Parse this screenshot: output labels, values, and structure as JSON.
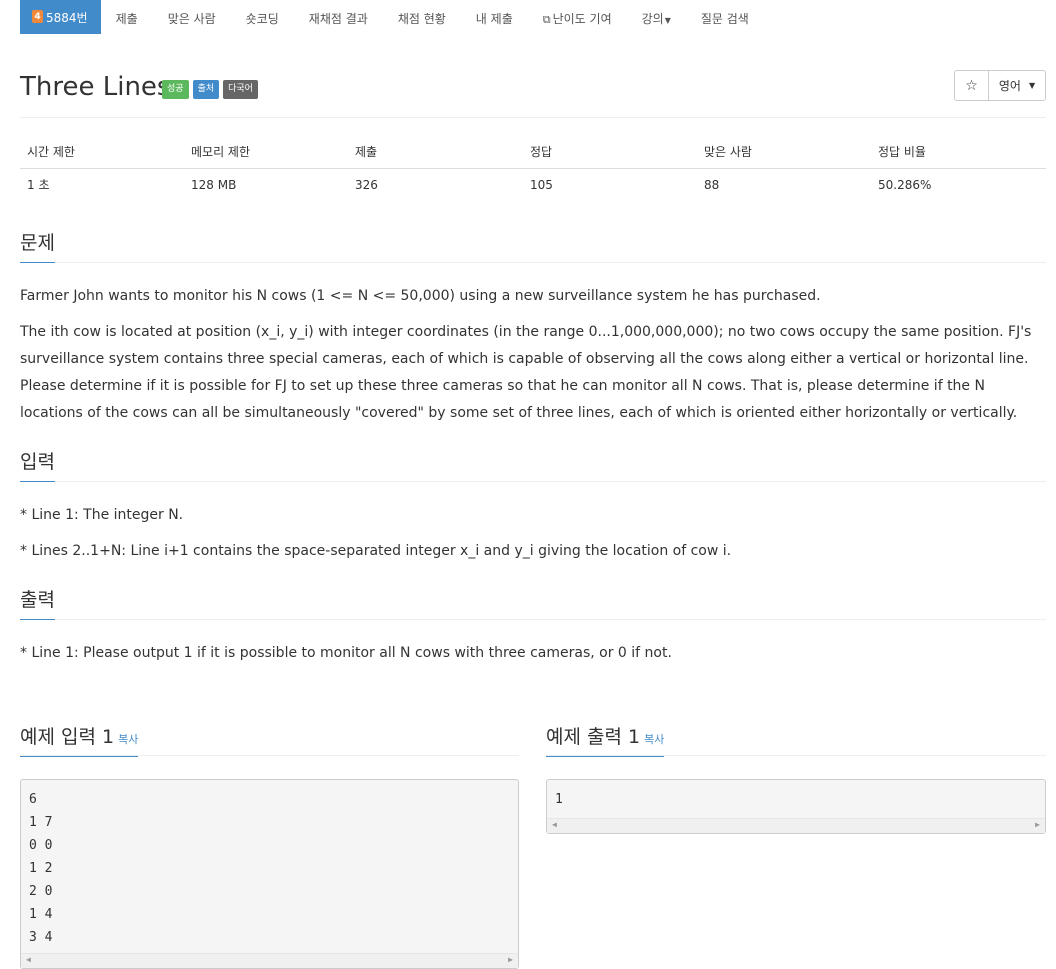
{
  "nav": {
    "problem_number": "5884번",
    "tier_badge": "4",
    "items": [
      "제출",
      "맞은 사람",
      "숏코딩",
      "재채점 결과",
      "채점 현황",
      "내 제출",
      "난이도 기여",
      "강의",
      "질문 검색"
    ]
  },
  "problem": {
    "title": "Three Lines",
    "labels": [
      {
        "text": "성공",
        "color": "#5cb85c"
      },
      {
        "text": "출처",
        "color": "#428bca"
      },
      {
        "text": "다국어",
        "color": "#666666"
      }
    ],
    "star": "☆",
    "language": "영어"
  },
  "info": {
    "headers": [
      "시간 제한",
      "메모리 제한",
      "제출",
      "정답",
      "맞은 사람",
      "정답 비율"
    ],
    "values": [
      "1 초",
      "128 MB",
      "326",
      "105",
      "88",
      "50.286%"
    ]
  },
  "sections": {
    "description_title": "문제",
    "description": [
      "Farmer John wants to monitor his N cows (1 <= N <= 50,000) using a new surveillance system he has purchased.",
      "The ith cow is located at position (x_i, y_i) with integer coordinates (in the range 0...1,000,000,000); no two cows occupy the same position.  FJ's surveillance system contains three special cameras, each of which is capable of observing all the cows along either a vertical or horizontal line.  Please determine if it is possible for FJ to set up these three cameras so that he can monitor all N cows.  That is, please determine if the N locations of the cows can all be simultaneously \"covered\" by some set of three lines, each of which is oriented either horizontally or vertically."
    ],
    "input_title": "입력",
    "input": [
      "* Line 1: The integer N.",
      "* Lines 2..1+N: Line i+1 contains the space-separated integer x_i and y_i giving the location of cow i."
    ],
    "output_title": "출력",
    "output": [
      "* Line 1: Please output 1 if it is possible to monitor all N cows with three cameras, or 0 if not."
    ]
  },
  "samples": {
    "input_title": "예제 입력 1",
    "output_title": "예제 출력 1",
    "copy_label": "복사",
    "input_lines": [
      "6",
      "1 7",
      "0 0",
      "1 2",
      "2 0",
      "1 4",
      "3 4"
    ],
    "output_lines": [
      "1"
    ]
  },
  "colors": {
    "accent": "#428bca",
    "success": "#5cb85c",
    "tier": "#f0883a"
  }
}
